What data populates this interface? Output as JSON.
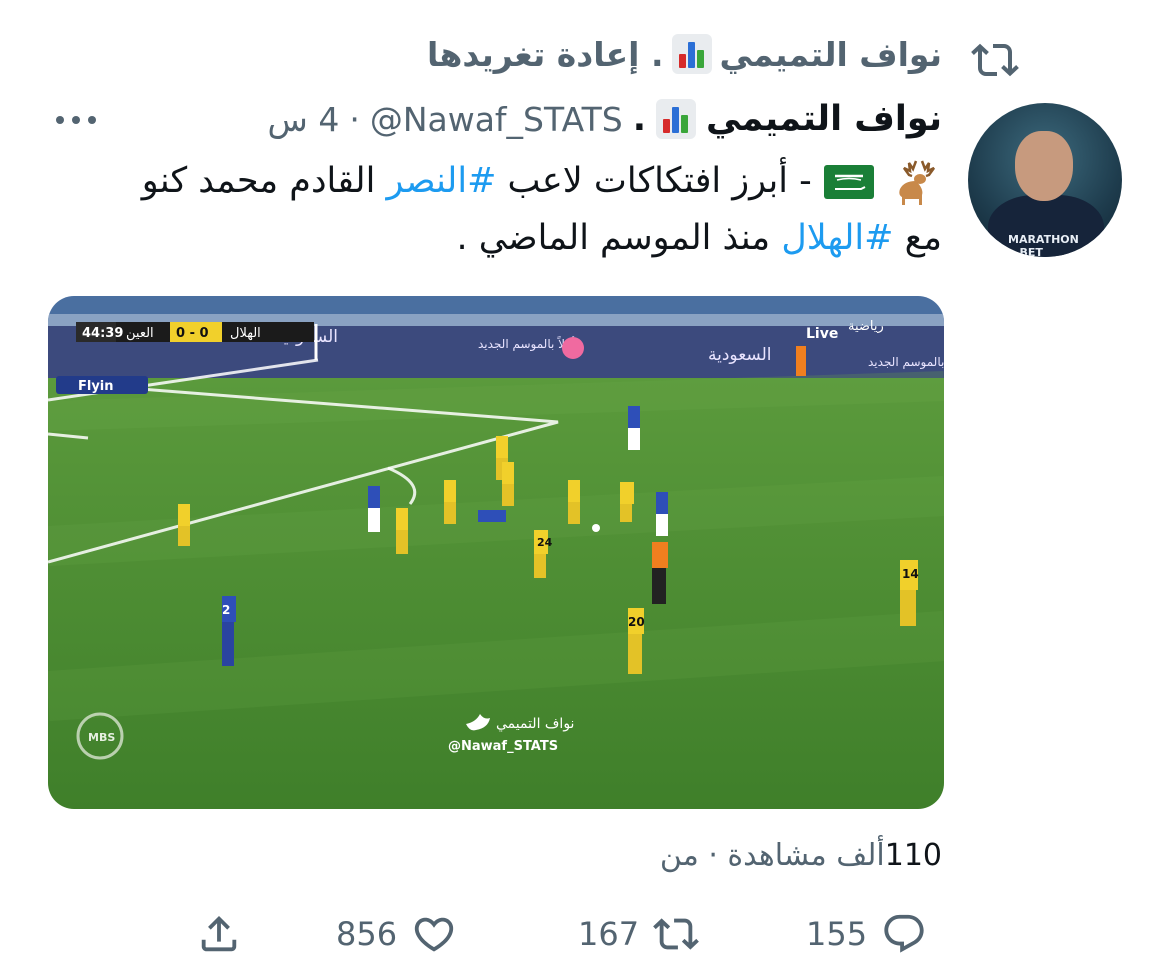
{
  "retweet": {
    "icon": "retweet-icon",
    "name": "نواف التميمي",
    "label": ". إعادة تغريدها"
  },
  "tweet": {
    "author_name": "نواف التميمي",
    "separator": ".",
    "handle": "@Nawaf_STATS",
    "time_separator": "·",
    "time": "4 س",
    "text_parts": {
      "p1": "- أبرز افتكاكات لاعب ",
      "hashtag1": "#النصر",
      "p2": " القادم محمد كنو مع ",
      "hashtag2": "#الهلال",
      "p3": " منذ الموسم الماضي ."
    },
    "emojis": [
      "deer-icon",
      "saudi-flag-icon"
    ]
  },
  "media": {
    "scoreboard": {
      "time": "44:39",
      "team_a": "العين",
      "score": "0 - 0",
      "team_b": "الهلال"
    },
    "broadcaster": "Live",
    "channel": "رياضية",
    "ad_board_1": "السعودية",
    "ad_board_2": "أهلاً بالموسم الجديد",
    "ad_board_3": "السعودية",
    "ad_board_4": "أهلاً بالموسم الجديد",
    "watermark_name": "نواف التميمي",
    "watermark_handle": "@Nawaf_STATS",
    "league_logo": "MBS",
    "sponsor": "Flyin",
    "shirt_numbers": [
      "24",
      "14",
      "20",
      "2"
    ]
  },
  "views": {
    "count": "110",
    "text": "ألف مشاهدة · من"
  },
  "actions": {
    "reply_count": "155",
    "retweet_count": "167",
    "like_count": "856"
  },
  "colors": {
    "accent": "#1d9bf0",
    "muted": "#536471",
    "text": "#0f1419",
    "pitch": "#4d8f32",
    "yellow_kit": "#f1d02b",
    "blue_kit": "#2e4fb8"
  }
}
